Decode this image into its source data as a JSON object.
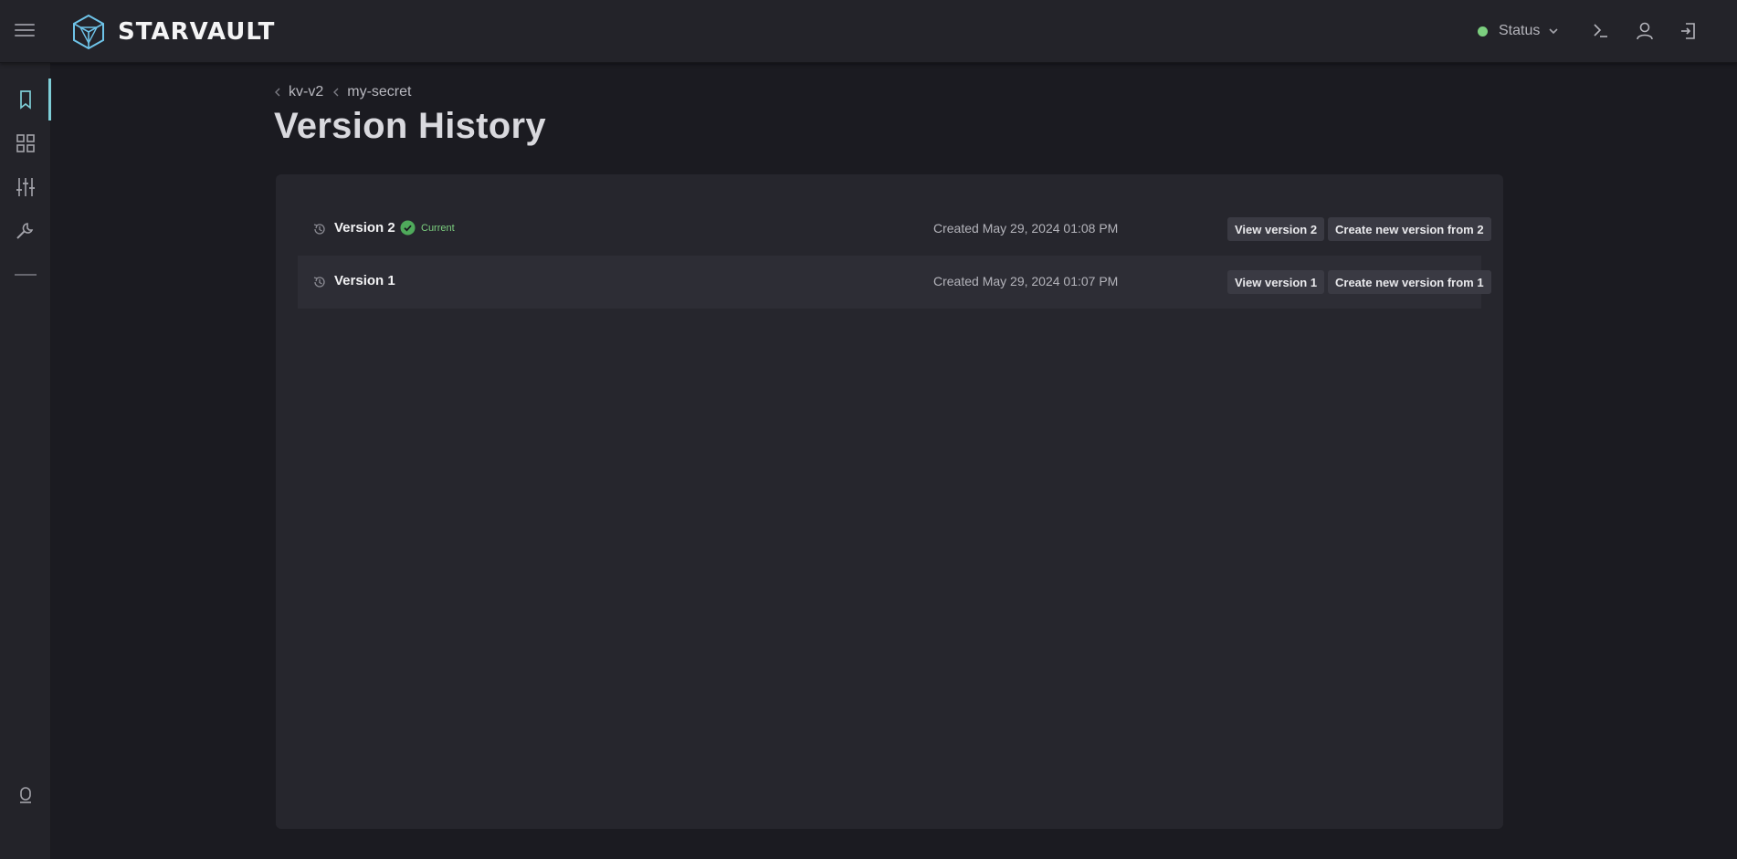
{
  "app": {
    "brand": "STARVAULT",
    "status_label": "Status",
    "colors": {
      "accent": "#7ecdd6",
      "status_ok": "#7ccf7f",
      "logo": "#6ec3e8"
    }
  },
  "header_icons": [
    "terminal-icon",
    "user-icon",
    "logout-icon"
  ],
  "sidebar": {
    "items": [
      {
        "icon": "bookmark-icon",
        "active": true
      },
      {
        "icon": "grid-icon",
        "active": false
      },
      {
        "icon": "sliders-icon",
        "active": false
      },
      {
        "icon": "wrench-icon",
        "active": false
      }
    ],
    "footer_icon": "vault-help-icon"
  },
  "breadcrumb": [
    {
      "label": "kv-v2"
    },
    {
      "label": "my-secret"
    }
  ],
  "page_title": "Version History",
  "versions": [
    {
      "name": "Version 2",
      "badge": "Current",
      "created": "Created May 29, 2024 01:08 PM",
      "view_label": "View version 2",
      "create_label": "Create new version from 2"
    },
    {
      "name": "Version 1",
      "badge": "",
      "created": "Created May 29, 2024 01:07 PM",
      "view_label": "View version 1",
      "create_label": "Create new version from 1"
    }
  ]
}
